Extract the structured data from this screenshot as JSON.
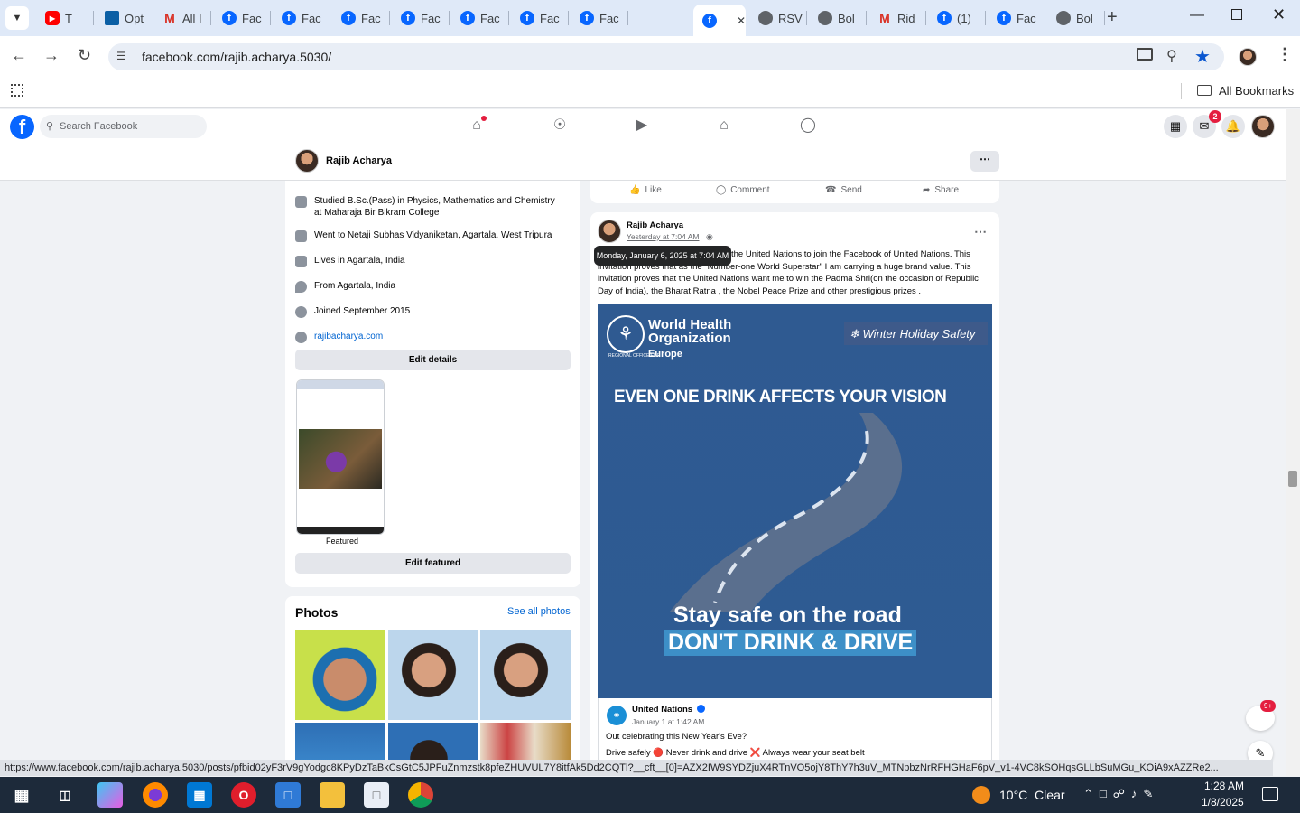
{
  "browser": {
    "tabs": [
      {
        "label": "T",
        "icon": "youtube-icon"
      },
      {
        "label": "Opt",
        "icon": "bookmark-icon"
      },
      {
        "label": "All I",
        "icon": "gmail-icon"
      },
      {
        "label": "Fac",
        "icon": "facebook-icon"
      },
      {
        "label": "Fac",
        "icon": "facebook-icon"
      },
      {
        "label": "Fac",
        "icon": "facebook-icon"
      },
      {
        "label": "Fac",
        "icon": "facebook-icon"
      },
      {
        "label": "Fac",
        "icon": "facebook-icon"
      },
      {
        "label": "Fac",
        "icon": "facebook-icon"
      },
      {
        "label": "Fac",
        "icon": "facebook-icon"
      },
      {
        "label": "",
        "icon": "facebook-icon",
        "active": true
      },
      {
        "label": "RSV",
        "icon": "globe-icon"
      },
      {
        "label": "Bol",
        "icon": "globe-icon"
      },
      {
        "label": "Rid",
        "icon": "gmail-icon"
      },
      {
        "label": "(1)",
        "icon": "facebook-icon"
      },
      {
        "label": "Fac",
        "icon": "facebook-icon"
      },
      {
        "label": "Bol",
        "icon": "globe-icon"
      }
    ],
    "url": "facebook.com/rajib.acharya.5030/",
    "bookmarks_label": "All Bookmarks",
    "status_url": "https://www.facebook.com/rajib.acharya.5030/posts/pfbid02yF3rV9gYodgc8KPyDzTaBkCsGtC5JPFuZnmzstk8pfeZHUVUL7Y8itfAk5Dd2CQTl?__cft__[0]=AZX2IW9SYDZjuX4RTnVO5ojY8ThY7h3uV_MTNpbzNrRFHGHaF6pV_v1-4VC8kSOHqsGLLbSuMGu_KOiA9xAZZRe2..."
  },
  "facebook": {
    "search_placeholder": "Search Facebook",
    "messenger_badge": "2",
    "profile_name": "Rajib Acharya",
    "intro": [
      "Studied B.Sc.(Pass) in Physics, Mathematics and Chemistry at Maharaja Bir Bikram College",
      "Went to Netaji Subhas Vidyaniketan, Agartala, West Tripura",
      "Lives in Agartala, India",
      "From Agartala, India",
      "Joined September 2015",
      "rajibacharya.com"
    ],
    "edit_details": "Edit details",
    "featured_label": "Featured",
    "edit_featured": "Edit featured",
    "photos_title": "Photos",
    "see_all_photos": "See all photos",
    "actions": {
      "like": "Like",
      "comment": "Comment",
      "send": "Send",
      "share": "Share"
    },
    "post": {
      "author": "Rajib Acharya",
      "time": "Yesterday at 7:04 AM",
      "tooltip": "Monday, January 6, 2025 at 7:04 AM",
      "text_visible": "the United Nations to join the Facebook of United Nations. This invitation proves that as the \"Number-one World Superstar\" I am carrying a huge brand value. This invitation proves that the United Nations want me to win the Padma Shri(on the occasion of Republic Day of India), the Bharat Ratna , the Nobel Peace Prize and other prestigious prizes .",
      "image": {
        "org1": "World Health",
        "org2": "Organization",
        "region_small": "REGIONAL OFFICE FOR",
        "region": "Europe",
        "badge": "Winter Holiday Safety",
        "headline": "EVEN ONE DRINK AFFECTS YOUR VISION",
        "line1": "Stay safe on the road",
        "line2": "DON'T DRINK & DRIVE"
      },
      "shared": {
        "author": "United Nations",
        "time": "January 1 at 1:42 AM",
        "text1": "Out celebrating this New Year's Eve?",
        "text2": "Drive safely 🔴 Never drink and drive ❌ Always wear your seat belt"
      }
    },
    "news_badge": "9+"
  },
  "taskbar": {
    "weather": "10°C  Clear",
    "time": "1:28 AM",
    "date": "1/8/2025"
  }
}
